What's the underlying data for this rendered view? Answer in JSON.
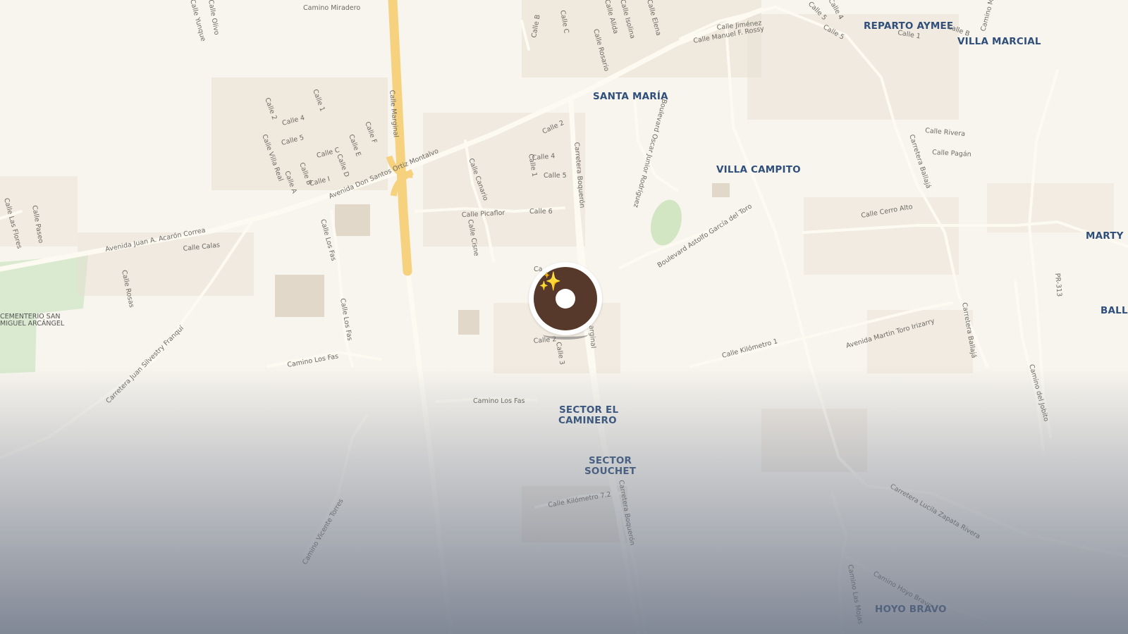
{
  "map": {
    "background": "#f8f5ee",
    "colors": {
      "highway": "#f6d27f",
      "road": "#fdfaf2",
      "building": "#e8dfd1",
      "park": "#d9ead0",
      "place_label": "#2f4f7a"
    },
    "places": {
      "santa_maria": "SANTA MARÍA",
      "reparto_aymee": "REPARTO AYMEE",
      "villa_marcial": "VILLA MARCIAL",
      "villa_campito": "VILLA CAMPITO",
      "marty": "MARTY",
      "balla": "BALLA",
      "sector_el_caminero_1": "SECTOR EL",
      "sector_el_caminero_2": "CAMINERO",
      "sector_souchet_1": "SECTOR",
      "sector_souchet_2": "SOUCHET",
      "hoyo_bravo": "HOYO BRAVO",
      "cementerio_1": "CEMENTERIO SAN",
      "cementerio_2": "MIGUEL ARCÁNGEL"
    },
    "roads": {
      "camino_miradero": "Camino Miradero",
      "calle_olivo": "Calle Olivo",
      "calle_yunque": "Calle Yunque",
      "calle_b_top": "Calle B",
      "calle_c_top": "Calle C",
      "calle_alida": "Calle Alida",
      "calle_rosario": "Calle Rosario",
      "calle_isolina": "Calle Isolina",
      "calle_elena": "Calle Elena",
      "calle_jimenez": "Calle Jiménez",
      "calle_manuel": "Calle Manuel F. Rossy",
      "calle_5_top": "Calle 5",
      "calle_4_top": "Calle 4",
      "calle_1_top": "Calle 1",
      "calle_b_right": "Calle B",
      "camino_m": "Camino M",
      "calle_marginal": "Calle Marginal",
      "avenida_don_santos": "Avenida Don Santos Ortiz Montalvo",
      "avenida_juan": "Avenida Juan A. Acarón Correa",
      "calle_calas": "Calle Calas",
      "calle_rosas": "Calle Rosas",
      "calle_las_flores": "Calle Las Flores",
      "calle_paseo": "Calle Paseo",
      "calle_villa_real": "Calle Villa Real",
      "calle_2_left": "Calle 2",
      "calle_4_left": "Calle 4",
      "calle_5_left": "Calle 5",
      "calle_1_left": "Calle 1",
      "calle_c_left": "Calle C",
      "calle_i_left": "Calle I",
      "calle_a_left": "Calle A",
      "calle_b_left": "Calle B",
      "calle_d_left": "Calle D",
      "calle_e_left": "Calle E",
      "calle_f_left": "Calle F",
      "calle_los_fas_1": "Calle Los Fas",
      "calle_los_fas_2": "Calle Los Fas",
      "camino_los_fas_1": "Camino Los Fas",
      "camino_los_fas_2": "Camino Los Fas",
      "carretera_juan": "Carretera Juan Silvestry Franquí",
      "calle_canario": "Calle Canario",
      "calle_picaflor": "Calle Picaflor",
      "calle_cisne": "Calle Cisne",
      "calle_2_mid": "Calle 2",
      "calle_4_mid": "Calle 4",
      "calle_1_mid": "Calle 1",
      "calle_5_mid": "Calle 5",
      "calle_6_mid": "Calle 6",
      "calle_2_low": "Calle 2",
      "calle_3_low": "Calle 3",
      "carretera_boqueron_1": "Carretera Boquerón",
      "carretera_boqueron_2": "Carretera Boquerón",
      "marginal_short": "arginal",
      "calle_c_mid": "Ca",
      "boulevard_oscar": "Boulevard Oscar Junior Rodríguez",
      "boulevard_astolfo": "Boulevard Astolfo García del Toro",
      "carretera_ballaja_1": "Carretera Ballajá",
      "carretera_ballaja_2": "Carretera Ballajá",
      "calle_rivera": "Calle Rivera",
      "calle_pagan": "Calle Pagán",
      "calle_cerro_alto": "Calle Cerro Alto",
      "pr_313": "PR-313",
      "avenida_martin": "Avenida Martin Toro Irizarry",
      "calle_km_1": "Calle Kilómetro 1",
      "calle_km_7_2": "Calle Kilómetro 7.2",
      "camino_del_jobito": "Camino del Jobito",
      "carretera_lucila": "Carretera Lucila Zapata Rivera",
      "camino_hoyo_bravo": "Camino Hoyo Bravo",
      "camino_las_mojas": "Camino Las Mojas",
      "camino_vicente": "Camino Vicente Torres"
    }
  },
  "marker": {
    "icon": "sparkles-icon",
    "disc_color": "#56392a",
    "sparkle_color": "#f3c23a"
  }
}
